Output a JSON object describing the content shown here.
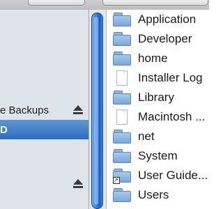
{
  "sidebar": {
    "items": [
      {
        "label": "e Backups",
        "ejectable": true,
        "selected": false
      },
      {
        "label": "D",
        "ejectable": false,
        "selected": true
      },
      {
        "label": "",
        "ejectable": true,
        "selected": false
      }
    ]
  },
  "files": {
    "items": [
      {
        "name": "Application",
        "icon": "folder-icon"
      },
      {
        "name": "Developer",
        "icon": "folder-icon"
      },
      {
        "name": "home",
        "icon": "folder-icon"
      },
      {
        "name": "Installer Log",
        "icon": "document-icon"
      },
      {
        "name": "Library",
        "icon": "folder-icon"
      },
      {
        "name": "Macintosh ...",
        "icon": "document-icon"
      },
      {
        "name": "net",
        "icon": "folder-icon"
      },
      {
        "name": "System",
        "icon": "folder-icon"
      },
      {
        "name": "User Guide...",
        "icon": "alias-folder-icon"
      },
      {
        "name": "Users",
        "icon": "folder-icon"
      }
    ]
  },
  "colors": {
    "sidebar_bg": "#dde4ec",
    "selection": "#2f6cbd",
    "scroll_thumb": "#2e7ee0"
  }
}
